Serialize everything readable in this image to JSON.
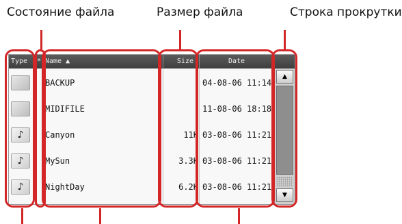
{
  "callouts": {
    "file_status": "Состояние файла",
    "file_size": "Размер файла",
    "scroll_bar": "Строка прокрутки"
  },
  "header": {
    "type": "Type",
    "status_mark": "*",
    "name": "Name ▲",
    "size": "Size",
    "date": "Date"
  },
  "files": [
    {
      "icon": "folder-icon",
      "icon_glyph": "",
      "name": "BACKUP",
      "size": "",
      "date": "04-08-06 11:14"
    },
    {
      "icon": "folder-icon",
      "icon_glyph": "",
      "name": "MIDIFILE",
      "size": "",
      "date": "11-08-06 18:18"
    },
    {
      "icon": "music-note-icon",
      "icon_glyph": "♪",
      "name": "Canyon",
      "size": "11K",
      "date": "03-08-06 11:21"
    },
    {
      "icon": "music-note-icon",
      "icon_glyph": "♪",
      "name": "MySun",
      "size": "3.3K",
      "date": "03-08-06 11:21"
    },
    {
      "icon": "music-note-icon",
      "icon_glyph": "♪",
      "name": "NightDay",
      "size": "6.2K",
      "date": "03-08-06 11:21"
    }
  ],
  "scrollbar": {
    "up_arrow": "▲",
    "down_arrow": "▼"
  },
  "colors": {
    "highlight": "#d32727",
    "header_bg": "#4a4a4a",
    "list_bg": "#f8f8f8"
  }
}
